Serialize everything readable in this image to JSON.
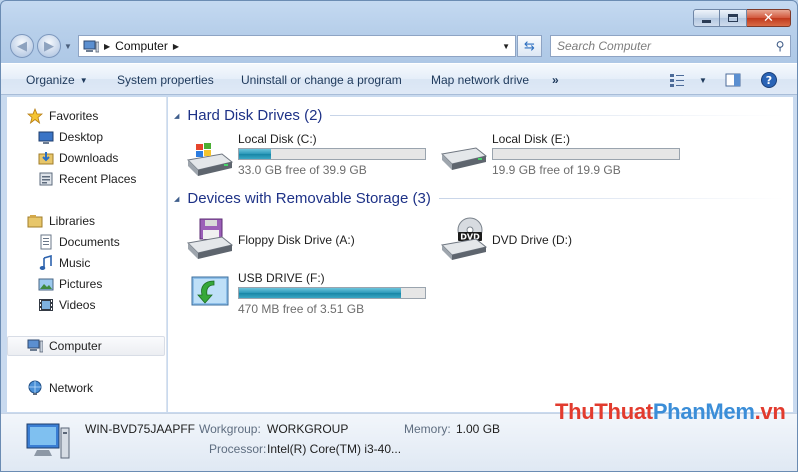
{
  "address": {
    "crumb": "Computer"
  },
  "search": {
    "placeholder": "Search Computer"
  },
  "toolbar": {
    "organize": "Organize",
    "system_properties": "System properties",
    "uninstall": "Uninstall or change a program",
    "map_network": "Map network drive",
    "more": "»"
  },
  "nav": {
    "favorites": "Favorites",
    "desktop": "Desktop",
    "downloads": "Downloads",
    "recent_places": "Recent Places",
    "libraries": "Libraries",
    "documents": "Documents",
    "music": "Music",
    "pictures": "Pictures",
    "videos": "Videos",
    "computer": "Computer",
    "network": "Network"
  },
  "groups": {
    "hard_disks": "Hard Disk Drives (2)",
    "removable": "Devices with Removable Storage (3)"
  },
  "drives": {
    "c": {
      "name": "Local Disk (C:)",
      "free_text": "33.0 GB free of 39.9 GB",
      "used_fraction": 0.17
    },
    "e": {
      "name": "Local Disk (E:)",
      "free_text": "19.9 GB free of 19.9 GB",
      "used_fraction": 0.0
    },
    "a": {
      "name": "Floppy Disk Drive (A:)"
    },
    "d": {
      "name": "DVD Drive (D:)",
      "badge": "DVD"
    },
    "f": {
      "name": "USB DRIVE (F:)",
      "free_text": "470 MB free of 3.51 GB",
      "used_fraction": 0.87
    }
  },
  "details": {
    "computer_name": "WIN-BVD75JAAPFF",
    "workgroup_label": "Workgroup:",
    "workgroup_value": "WORKGROUP",
    "memory_label": "Memory:",
    "memory_value": "1.00 GB",
    "processor_label": "Processor:",
    "processor_value": "Intel(R) Core(TM) i3-40..."
  },
  "watermark": {
    "part1": "Thu",
    "part2": "Thuat",
    "part3": "PhanMem",
    "part4": ".vn"
  },
  "colors": {
    "accent": "#1e3287",
    "bar_fill": "#2a98b8"
  }
}
